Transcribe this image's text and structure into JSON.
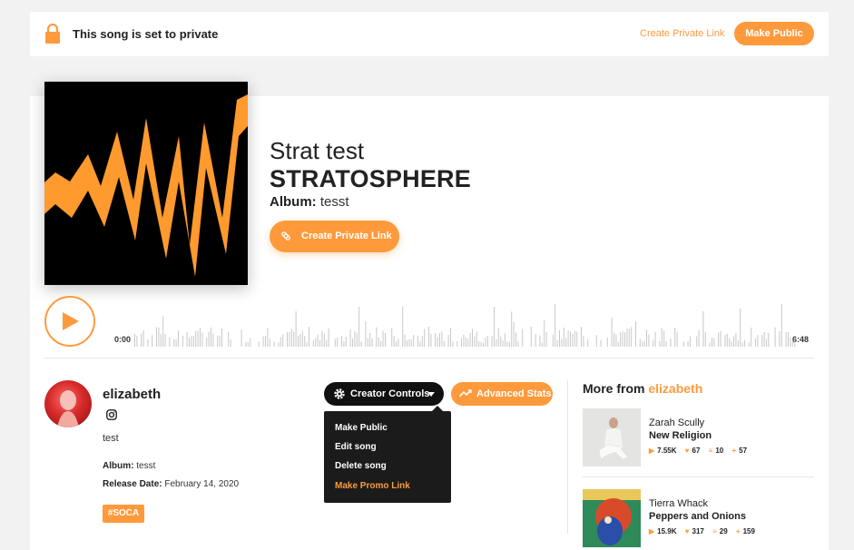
{
  "privacy": {
    "message": "This song is set to private",
    "create_link": "Create Private Link",
    "make_public": "Make Public"
  },
  "song": {
    "artist": "Strat test",
    "title": "STRATOSPHERE",
    "album_label": "Album:",
    "album": "tesst",
    "create_link_button": "Create Private Link"
  },
  "player": {
    "time_start": "0:00",
    "time_end": "6:48"
  },
  "uploader": {
    "name": "elizabeth",
    "bio": "test",
    "album_label": "Album:",
    "album": "tesst",
    "release_label": "Release Date:",
    "release_date": "February 14, 2020",
    "tag": "#SOCA"
  },
  "actions": {
    "creator_controls": "Creator Controls",
    "advanced_stats": "Advanced Stats",
    "menu": [
      "Make Public",
      "Edit song",
      "Delete song",
      "Make Promo Link"
    ]
  },
  "more_from": {
    "prefix": "More from",
    "artist": "elizabeth",
    "items": [
      {
        "artist": "Zarah Scully",
        "title": "New Religion",
        "plays": "7.55K",
        "likes": "67",
        "playlists": "10",
        "reups": "57"
      },
      {
        "artist": "Tierra Whack",
        "title": "Peppers and Onions",
        "plays": "15.9K",
        "likes": "317",
        "playlists": "29",
        "reups": "159"
      }
    ]
  },
  "colors": {
    "accent": "#ff9a3c",
    "dark": "#111111",
    "background": "#f2f2f2"
  }
}
